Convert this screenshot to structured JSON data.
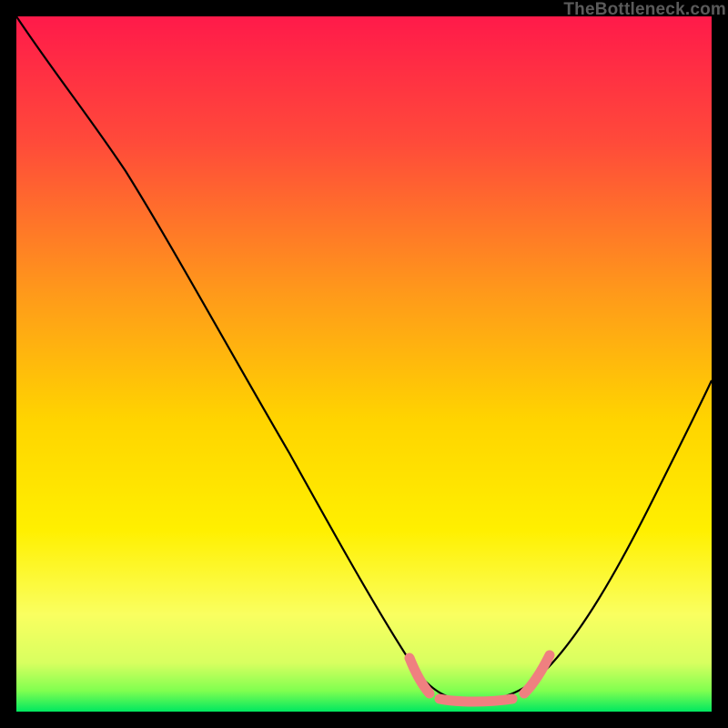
{
  "watermark": "TheBottleneck.com",
  "chart_data": {
    "type": "line",
    "title": "",
    "xlabel": "",
    "ylabel": "",
    "xlim": [
      0,
      100
    ],
    "ylim": [
      0,
      100
    ],
    "gradient_stops": [
      {
        "offset": 0,
        "color": "#ff1a4a"
      },
      {
        "offset": 18,
        "color": "#ff4a3a"
      },
      {
        "offset": 40,
        "color": "#ff9a1a"
      },
      {
        "offset": 58,
        "color": "#ffd400"
      },
      {
        "offset": 74,
        "color": "#fff000"
      },
      {
        "offset": 86,
        "color": "#faff60"
      },
      {
        "offset": 93,
        "color": "#d8ff60"
      },
      {
        "offset": 97,
        "color": "#80ff50"
      },
      {
        "offset": 100,
        "color": "#00e860"
      }
    ],
    "series": [
      {
        "name": "bottleneck-curve",
        "color": "#000000",
        "x": [
          0,
          6,
          12,
          18,
          24,
          30,
          36,
          42,
          48,
          54,
          58,
          62,
          65,
          68,
          72,
          76,
          80,
          85,
          90,
          95,
          100
        ],
        "y": [
          100,
          95,
          88,
          80,
          72,
          63,
          54,
          45,
          36,
          26,
          16,
          8,
          3,
          1,
          1,
          2,
          6,
          14,
          26,
          40,
          55
        ]
      },
      {
        "name": "optimal-zone-highlight",
        "color": "#f28080",
        "x": [
          58,
          60,
          62,
          64,
          66,
          68,
          70,
          72,
          74,
          76,
          78,
          80
        ],
        "y": [
          10,
          7,
          5,
          3,
          2,
          2,
          2,
          2,
          3,
          4,
          6,
          9
        ]
      }
    ],
    "annotations": []
  }
}
